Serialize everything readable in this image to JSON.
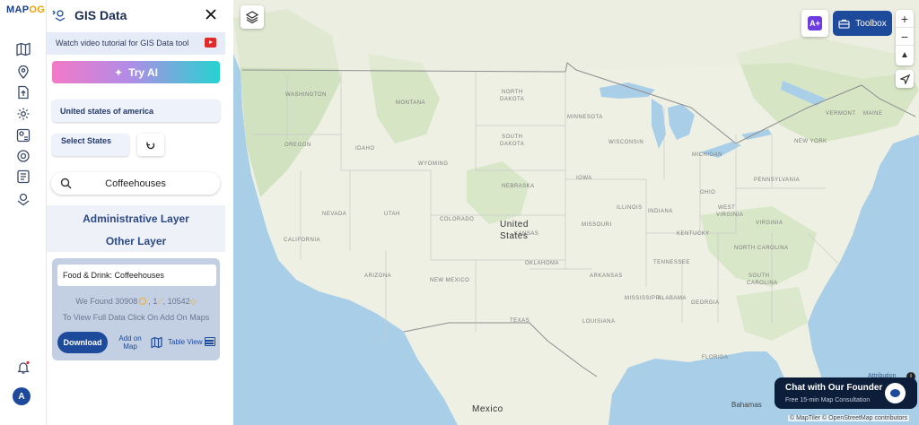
{
  "app": {
    "logo_text_a": "MAP",
    "logo_text_b": "OG",
    "user_initial": "A"
  },
  "panel": {
    "title": "GIS Data",
    "tutorial_text": "Watch video tutorial for GIS Data tool",
    "try_ai_label": "Try AI",
    "country_value": "United states of america",
    "select_states_label": "Select States",
    "search_value": "Coffeehouses",
    "administrative_layer": "Administrative Layer",
    "other_layer": "Other Layer"
  },
  "result": {
    "category": "Food & Drink: Coffeehouses",
    "found_label": "We Found",
    "count_a": "30908",
    "count_b": "1",
    "count_c": "10542",
    "hint": "To View Full Data Click On Add On Maps",
    "download_label": "Download",
    "add_on_map_label": "Add on Map",
    "table_view_label": "Table View"
  },
  "map": {
    "toolbox_label": "Toolbox",
    "ai_button_label": "A+",
    "zoom_in": "+",
    "zoom_out": "−",
    "compass": "▲",
    "country_label_1": "United",
    "country_label_2": "States",
    "mexico_label": "Mexico",
    "bahamas_label": "Bahamas",
    "attribution_label": "Attribution",
    "chat_title": "Chat with Our Founder",
    "chat_subtitle": "Free 15-min Map Consultation",
    "copyright": "© MapTiler © OpenStreetMap contributors",
    "states": {
      "washington": "WASHINGTON",
      "montana": "MONTANA",
      "north_dakota_1": "NORTH",
      "north_dakota_2": "DAKOTA",
      "minnesota": "MINNESOTA",
      "oregon": "OREGON",
      "idaho": "IDAHO",
      "south_dakota_1": "SOUTH",
      "south_dakota_2": "DAKOTA",
      "wisconsin": "WISCONSIN",
      "michigan": "MICHIGAN",
      "wyoming": "WYOMING",
      "iowa": "IOWA",
      "nebraska": "NEBRASKA",
      "nevada": "NEVADA",
      "utah": "UTAH",
      "colorado": "COLORADO",
      "illinois": "ILLINOIS",
      "indiana": "INDIANA",
      "ohio": "OHIO",
      "pennsylvania": "PENNSYLVANIA",
      "new_york": "NEW YORK",
      "vermont": "VERMONT",
      "maine": "MAINE",
      "california": "CALIFORNIA",
      "kansas": "KANSAS",
      "missouri": "MISSOURI",
      "kentucky": "KENTUCKY",
      "west_virginia_1": "WEST",
      "west_virginia_2": "VIRGINIA",
      "virginia": "VIRGINIA",
      "arizona": "ARIZONA",
      "oklahoma": "OKLAHOMA",
      "arkansas": "ARKANSAS",
      "tennessee": "TENNESSEE",
      "north_carolina": "NORTH CAROLINA",
      "new_mexico": "NEW MEXICO",
      "south_carolina_1": "SOUTH",
      "south_carolina_2": "CAROLINA",
      "mississippi": "MISSISSIPPI",
      "alabama": "ALABAMA",
      "georgia": "GEORGIA",
      "texas": "TEXAS",
      "louisiana": "LOUISIANA",
      "florida": "FLORIDA"
    }
  },
  "colors": {
    "brand": "#1d4a9a",
    "water": "#a9cfe8",
    "land": "#eef0e4",
    "forest": "#c9dfb6"
  }
}
